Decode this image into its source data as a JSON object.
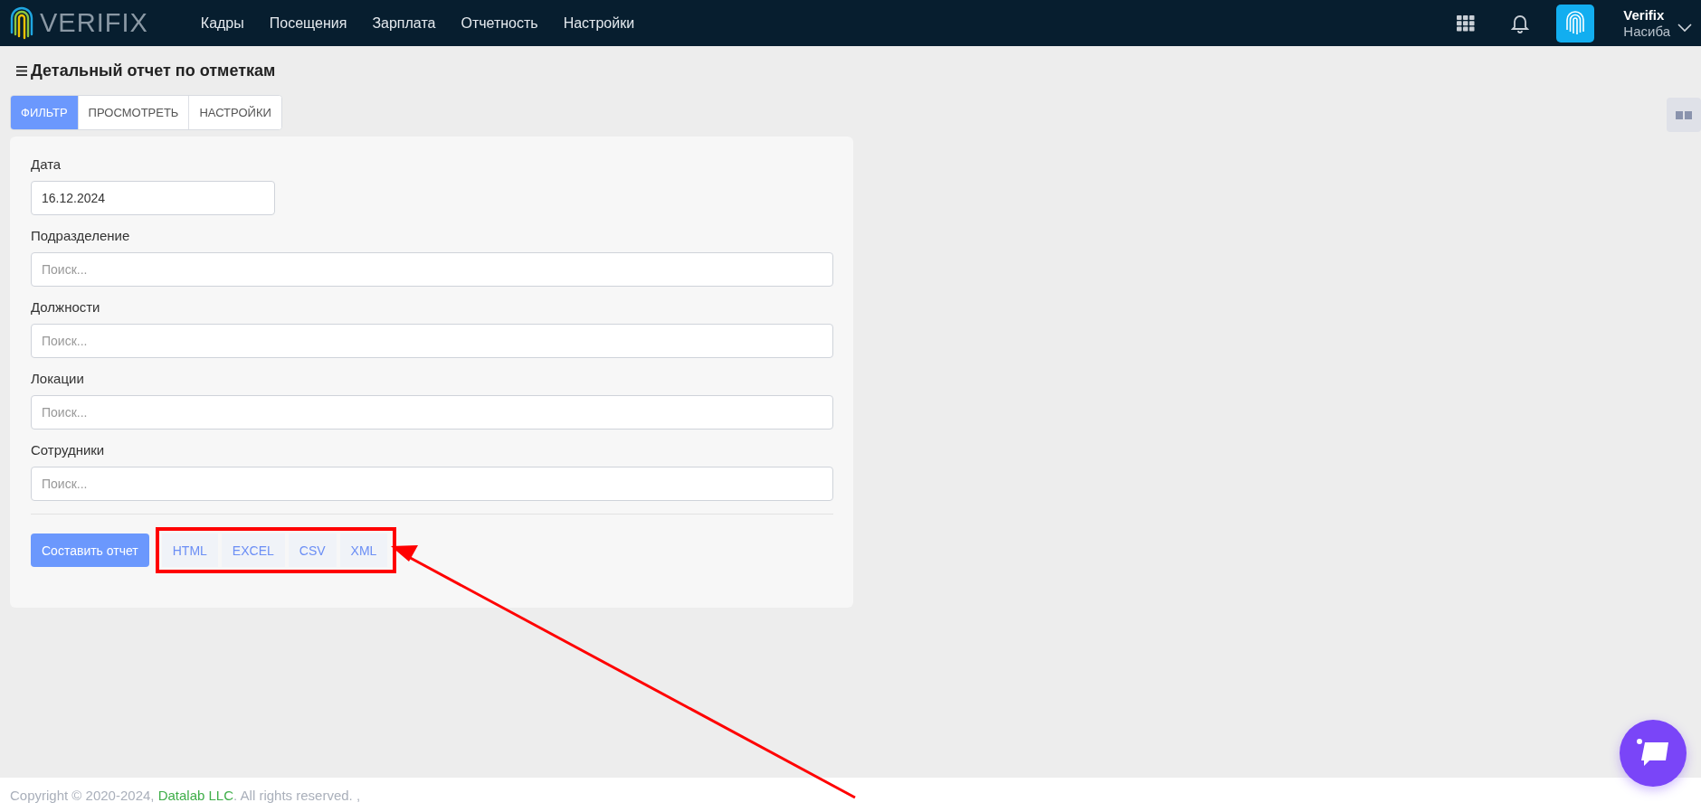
{
  "top_bar": {
    "logo_text": "VERIFIX",
    "nav": [
      {
        "label": "Кадры"
      },
      {
        "label": "Посещения"
      },
      {
        "label": "Зарплата"
      },
      {
        "label": "Отчетность"
      },
      {
        "label": "Настройки"
      }
    ],
    "user": {
      "company": "Verifix",
      "name": "Насиба"
    }
  },
  "page": {
    "title": "Детальный отчет по отметкам",
    "tabs": [
      {
        "label": "ФИЛЬТР",
        "selected": true
      },
      {
        "label": "ПРОСМОТРЕТЬ",
        "selected": false
      },
      {
        "label": "НАСТРОЙКИ",
        "selected": false
      }
    ],
    "fields": [
      {
        "label": "Дата",
        "value": "16.12.2024",
        "kind": "date"
      },
      {
        "label": "Подразделение",
        "placeholder": "Поиск...",
        "kind": "search"
      },
      {
        "label": "Должности",
        "placeholder": "Поиск...",
        "kind": "search"
      },
      {
        "label": "Локации",
        "placeholder": "Поиск...",
        "kind": "search"
      },
      {
        "label": "Сотрудники",
        "placeholder": "Поиск...",
        "kind": "search"
      }
    ],
    "primary_button": "Составить отчет",
    "export_buttons": [
      "HTML",
      "EXCEL",
      "CSV",
      "XML"
    ]
  },
  "footer": {
    "prefix": "Copyright © 2020-2024, ",
    "link": "Datalab LLC",
    "suffix": ". All rights reserved. ,"
  }
}
